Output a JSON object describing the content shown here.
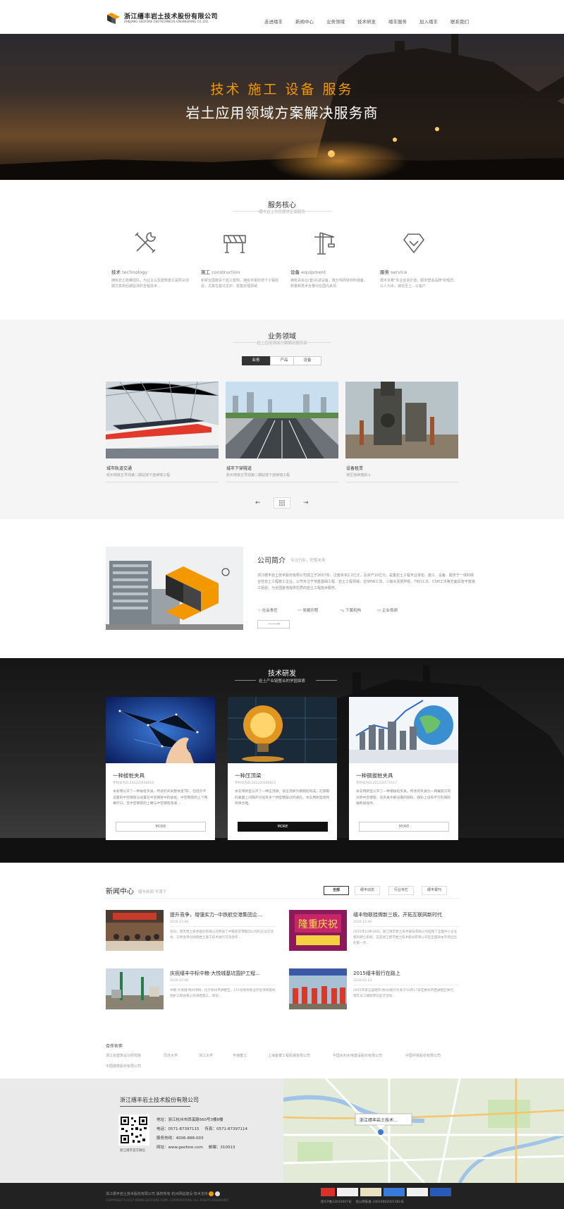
{
  "header": {
    "logo_cn": "浙江缙丰岩土技术股份有限公司",
    "logo_en": "ZHEJIANG GEOFORE GEOTECHNICAL ENGINEERING CO.,LTD.",
    "nav": [
      "走进缙丰",
      "新闻中心",
      "业务领域",
      "技术研发",
      "缙丰服务",
      "加入缙丰",
      "联系我们"
    ]
  },
  "hero": {
    "line1": "技术  施工  设备  服务",
    "line2": "岩土应用领域方案解决服务商"
  },
  "service": {
    "title": "服务核心",
    "subtitle": "缙丰岩土为您提供全面服务",
    "items": [
      {
        "name": "技术",
        "en": "technology",
        "desc": "拥有岩土勘察团队，为业主以及建筑施工提供从前期方案到后期监测的全程技术...",
        "icon": "tools-icon"
      },
      {
        "name": "施工",
        "en": "construction",
        "desc": "积累全国数百个岩工案例，拥有丰富的地下工程经验，尤其在基坑支护、桩基处理领域",
        "icon": "barrier-icon"
      },
      {
        "name": "设备",
        "en": "equipment",
        "desc": "拥有百余台(套)先进设备，数万吨周转材料储备，数量和技术含量均在国内具领",
        "icon": "crane-icon"
      },
      {
        "name": "服务",
        "en": "service",
        "desc": "缙丰本着\"专业创造价值，服务塑造品牌\"的理念，以人为本，诚信至上，以客户",
        "icon": "diamond-icon"
      }
    ]
  },
  "business": {
    "title": "业务领域",
    "subtitle": "岩土应用领域方案解决服务商",
    "tabs": [
      "业务",
      "产品",
      "设备"
    ],
    "cards": [
      {
        "title": "城市轨道交通",
        "desc": "杭州地铁五号线第二期站地下连续墙工程"
      },
      {
        "title": "城市下穿隧道",
        "desc": "杭州地铁五号线第二期站地下连续墙工程"
      },
      {
        "title": "设备租赁",
        "desc": "液压连续墙抓斗"
      }
    ],
    "prev": "←",
    "next": "→"
  },
  "about": {
    "title": "公司简介",
    "subtitle": "专注行业，积攒未来",
    "text": "浙江缙丰岩土技术股份有限公司成立于2007年，注册资本2.2亿元，总资产10亿元，是集岩土工程专业承包、施工、设备、服务于一体的综合性岩土工程施工企业。公司专注于地基基础工程、岩土工程领域，在SMW工法、三轴水泥搅拌桩、TRD工法、CSM工法等方面具有丰富施工经验，为全国各地提供优质的岩土工程技术服务。",
    "links": [
      "社会责任",
      "发展历程",
      "下属机构",
      "企业视频"
    ],
    "more": "——→"
  },
  "tech": {
    "title": "技术研发",
    "subtitle": "岩土产业链整合的学园探索",
    "cards": [
      {
        "title": "一种拔桩夹具",
        "no": "专利号为ZL201220408918",
        "desc": "本发明公开了一种拔桩夹具，所述的夹具整体呈T形，包括外平设置的中空钢管与设置在中空钢管中的拔桩，中空钢管的上下两端开口，且中空钢管的上端与中空钢管连通 ...",
        "btn": "MORE",
        "active": false
      },
      {
        "title": "一种压顶梁",
        "no": "专利号为ZL201220390823",
        "desc": "本实用新型公开了一种压顶梁，该压顶梁为钢筋砼构成，在钢筋的表面上间隔开切设有多个供型钢穿过的通孔。本实用新型结构简单合理。",
        "btn": "MORE",
        "active": true
      },
      {
        "title": "一种钢拔桩夹具",
        "no": "专利号为ZL201220575117",
        "desc": "本实用新型公开了一种钢拔桩夹具，所述的夹具为一两翼圆方的对称中空钢管，在夹具中部设置的圆轮，圆轮上设有平行的圆轮轴和加强件。",
        "btn": "MORE",
        "active": false
      }
    ]
  },
  "news": {
    "title": "新闻中心",
    "subtitle": "缙丰新闻 不落下",
    "tabs": [
      "全部",
      "缙丰动态",
      "行业专栏",
      "缙丰报刊"
    ],
    "items": [
      {
        "title": "提升竞争，增强实力--中铁航空港集团企...",
        "date": "2016-12-08",
        "desc": "近日，缙丰岩土技术股份有限公司参加了中铁航空港集团公司的企业交流会，与参会单位围绕岩土施工技术进行交流合作..."
      },
      {
        "title": "缙丰物联挂牌新三板，开拓互联网新时代",
        "date": "2016-12-08",
        "desc": "2015年10月19日，浙江缙丰岩土技术股份有限公司挂牌了全国中小企业股份转让系统，这是浙江缙丰岩土技术股份有限公司在全国资本市场迈出的第一步..."
      },
      {
        "title": "庆祝缙丰中标中粮·大悦城基坑围护工程...",
        "date": "2016-12-08",
        "desc": "中粮·大悦城·杭州项目，位于杭州市拱墅区，115号地块商业综合项目基坑围护工程由我公司承担施工，目前..."
      },
      {
        "title": "2015缙丰毅行在路上",
        "date": "2016-05-13",
        "desc": "2015年第五届缙丰(杭州)毅行大会于10月17日在杭州市西湖景区举行，缙丰员工踊跃参与此次活动..."
      }
    ]
  },
  "partners": {
    "title": "合作伙伴",
    "items": [
      "浙江省建筑设计研究院",
      "同济大学",
      "浙江大学",
      "宇通重工",
      "上海金泰工程机械有限公司",
      "中国水利水电建设股份有限公司",
      "中国中铁股份有限公司",
      "中国建筑股份有限公司"
    ]
  },
  "footer": {
    "company": "浙江缙丰岩土技术股份有限公司",
    "addr_label": "地址：",
    "addr": "浙江杭州市西溪路560号3楼8楼",
    "tel_label": "电话：",
    "tel": "0571-87397115",
    "fax_label": "传真：",
    "fax": "0571-87397114",
    "hotline_label": "服务热线：",
    "hotline": "4006-888-003",
    "web_label": "网址：",
    "web": "www.geofore.com",
    "post_label": "邮编：",
    "post": "310013",
    "qr_caption": "浙江缙丰官方微信",
    "map_label": "浙江缙丰岩土技术...",
    "copyright": "浙江缙丰岩土技术股份有限公司",
    "rights": "版权所有",
    "links": "杭州网站建设  技术支持",
    "copy_en": "COPYRIGHT©2017 WWW.GEOFORE.COM. CORPORATION. ALL RIGHTS RESERVED",
    "icp": "浙ICP备12032607号",
    "police": "浙公网安备 33010602001381号"
  },
  "colors": {
    "accent": "#f39800",
    "dark": "#222222"
  }
}
